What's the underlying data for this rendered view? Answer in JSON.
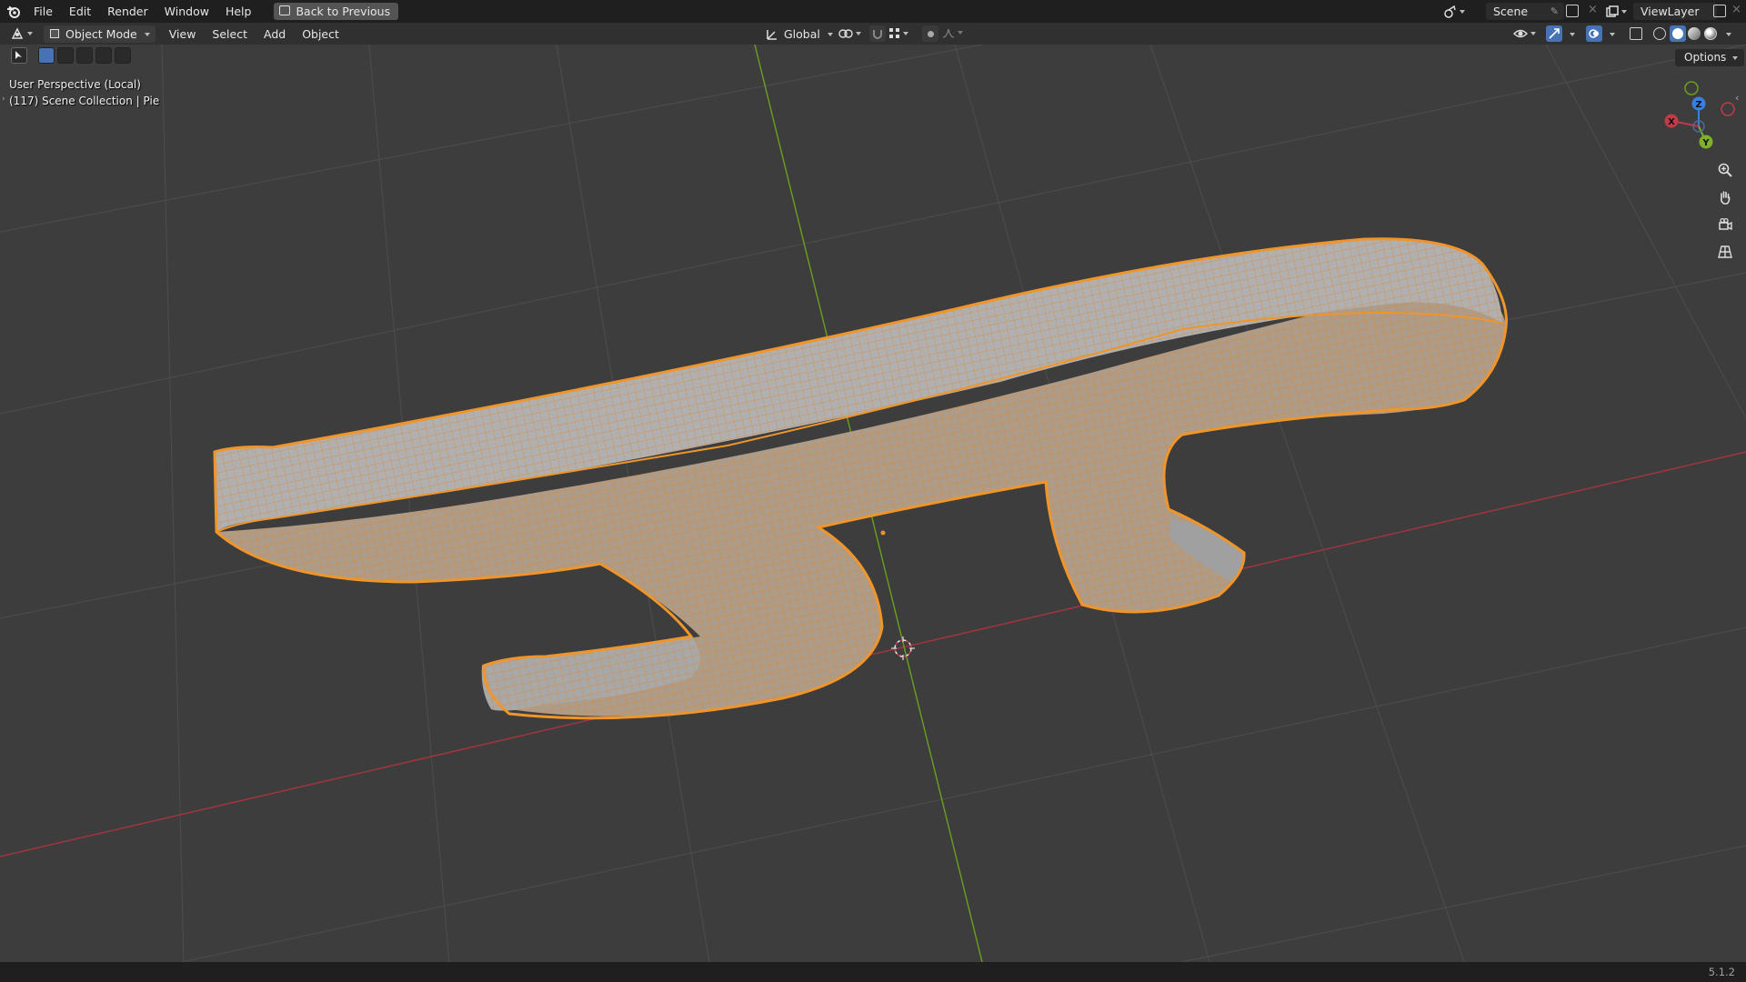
{
  "topbar": {
    "menus": [
      "File",
      "Edit",
      "Render",
      "Window",
      "Help"
    ],
    "back_label": "Back to Previous",
    "scene": "Scene",
    "view_layer": "ViewLayer"
  },
  "header": {
    "mode": "Object Mode",
    "menus": [
      "View",
      "Select",
      "Add",
      "Object"
    ],
    "orientation": "Global",
    "options_label": "Options"
  },
  "viewport": {
    "perspective": "User Perspective (Local)",
    "collection": "(117) Scene Collection | Pie"
  },
  "gizmo": {
    "x": "X",
    "y": "Y",
    "z": "Z"
  },
  "colors": {
    "selection": "#f0952a",
    "x_axis": "#c03a48",
    "y_axis": "#7fb02b",
    "z_axis": "#3a7fe0",
    "background": "#3d3d3d"
  },
  "status": {
    "version": "5.1.2"
  }
}
